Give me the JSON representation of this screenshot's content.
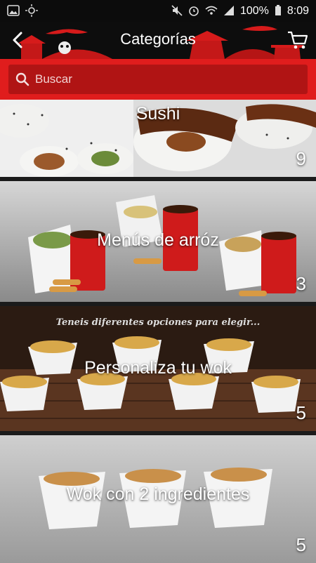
{
  "status": {
    "battery": "100%",
    "time": "8:09"
  },
  "header": {
    "title": "Categorías"
  },
  "search": {
    "placeholder": "Buscar"
  },
  "categories": [
    {
      "name": "Sushi",
      "count": "9"
    },
    {
      "name": "Menús de arróz",
      "count": "3"
    },
    {
      "name": "Personaliza tu wok",
      "count": "5",
      "banner": "Teneis diferentes opciones para elegir..."
    },
    {
      "name": "Wok con 2 ingredientes",
      "count": "5"
    }
  ],
  "colors": {
    "accent": "#e01d1d",
    "dark": "#0d0d0d"
  }
}
